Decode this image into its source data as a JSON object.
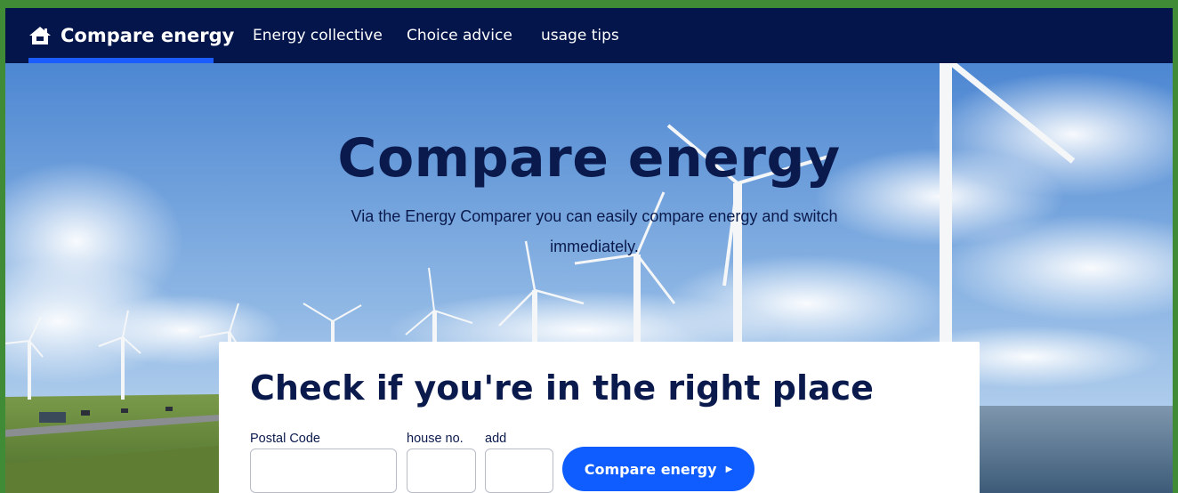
{
  "nav": {
    "brand_label": "Compare energy",
    "links": [
      {
        "label": "Energy collective"
      },
      {
        "label": "Choice advice"
      },
      {
        "label": "usage tips"
      }
    ],
    "colors": {
      "background": "#03154b",
      "active_underline": "#1a5cff"
    }
  },
  "hero": {
    "title": "Compare energy",
    "subtitle": "Via the Energy Comparer you can easily compare energy and switch immediately."
  },
  "form": {
    "title": "Check if you're in the right place",
    "postal_code_label": "Postal Code",
    "postal_code_value": "",
    "house_no_label": "house no.",
    "house_no_value": "",
    "addition_label": "add",
    "addition_value": "",
    "submit_label": "Compare energy",
    "submit_icon": "chevron-right-icon",
    "accent_color": "#0f5cff"
  }
}
